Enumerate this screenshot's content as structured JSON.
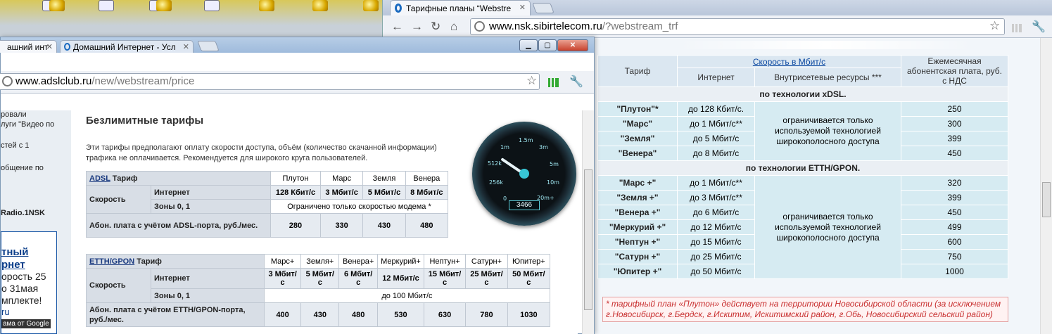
{
  "right_window": {
    "tab_title": "Тарифные планы “Webstre",
    "url_domain": "www.nsk.sibirtelecom.ru",
    "url_path": "/?webstream_trf",
    "table": {
      "head_tariff": "Тариф",
      "head_speed": "Скорость в Мбит/с",
      "head_internet": "Интернет",
      "head_intranet": "Внутрисетевые ресурсы ***",
      "head_fee": "Ежемесячная абонентская плата, руб. с НДС",
      "group_xdsl": "по технологии xDSL.",
      "group_etth": "по технологии ЕТТН/GPON.",
      "intranet_note": "ограничивается только используемой технологией широкополосного доступа",
      "xdsl_rows": [
        {
          "name": "\"Плутон\"*",
          "speed": "до 128 Кбит/с.",
          "fee": "250"
        },
        {
          "name": "\"Марс\"",
          "speed": "до 1 Мбит/с**",
          "fee": "300"
        },
        {
          "name": "\"Земля\"",
          "speed": "до 5 Мбит/с",
          "fee": "399"
        },
        {
          "name": "\"Венера\"",
          "speed": "до 8 Мбит/с",
          "fee": "450"
        }
      ],
      "etth_rows": [
        {
          "name": "\"Марс +\"",
          "speed": "до 1 Мбит/с**",
          "fee": "320"
        },
        {
          "name": "\"Земля +\"",
          "speed": "до 3 Мбит/с**",
          "fee": "399"
        },
        {
          "name": "\"Венера +\"",
          "speed": "до 6 Мбит/с",
          "fee": "450"
        },
        {
          "name": "\"Меркурий +\"",
          "speed": "до 12 Мбит/с",
          "fee": "499"
        },
        {
          "name": "\"Нептун +\"",
          "speed": "до 15 Мбит/с",
          "fee": "600"
        },
        {
          "name": "\"Сатурн +\"",
          "speed": "до 25 Мбит/с",
          "fee": "750"
        },
        {
          "name": "\"Юпитер +\"",
          "speed": "до 50 Мбит/с",
          "fee": "1000"
        }
      ]
    },
    "footnote": "* тарифный план «Плутон» действует на территории Новосибирской области (за исключением г.Новосибирск, г.Бердск, г.Искитим, Искитимский район, г.Обь, Новосибирский сельский район)"
  },
  "left_window": {
    "tab1_title": "ашний инт",
    "tab2_title": "Домашний Интернет - Усл",
    "url_domain": "www.adslclub.ru",
    "url_path": "/new/webstream/price",
    "sidebar": [
      "ровали",
      "луги \"Видео по",
      "стей с 1",
      "общение по",
      "Radio.1NSK"
    ],
    "promo": [
      "тный",
      "рнет",
      "орость 25",
      "о 31мая",
      "мплекте!",
      "ru",
      "ама от Google"
    ],
    "heading": "Безлимитные тарифы",
    "intro": "Эти тарифы предполагают оплату скорости доступа, объём (количество скачанной информации) трафика не оплачивается. Рекомендуется для широкого круга пользователей.",
    "adsl": {
      "label_link": "ADSL",
      "label_rest": " Тариф",
      "plans": [
        "Плутон",
        "Марс",
        "Земля",
        "Венера"
      ],
      "speed_label": "Скорость",
      "internet_label": "Интернет",
      "zones_label": "Зоны 0, 1",
      "internet": [
        "128 Кбит/с",
        "3 Мбит/с",
        "5 Мбит/с",
        "8 Мбит/с"
      ],
      "zones_value": "Ограничено только скоростью модема *",
      "fee_label": "Абон. плата с учётом ADSL-порта, руб./мес.",
      "fees": [
        "280",
        "330",
        "430",
        "480"
      ]
    },
    "etth": {
      "label_link": "ETTH/GPON",
      "label_rest": " Тариф",
      "plans": [
        "Марс+",
        "Земля+",
        "Венера+",
        "Меркурий+",
        "Нептун+",
        "Сатурн+",
        "Юпитер+"
      ],
      "speed_label": "Скорость",
      "internet_label": "Интернет",
      "zones_label": "Зоны 0, 1",
      "internet": [
        "3 Мбит/с",
        "5 Мбит/с",
        "6 Мбит/с",
        "12 Мбит/с",
        "15 Мбит/с",
        "25 Мбит/с",
        "50 Мбит/с"
      ],
      "zones_value": "до 100 Мбит/с",
      "fee_label": "Абон. плата с учётом ETTH/GPON-порта, руб./мес.",
      "fees": [
        "400",
        "430",
        "480",
        "530",
        "630",
        "780",
        "1030"
      ]
    },
    "gauge": {
      "labels": [
        "0",
        "256k",
        "512k",
        "1m",
        "1.5m",
        "3m",
        "5m",
        "10m",
        "20m+"
      ],
      "counter": "3466"
    }
  },
  "icons": [
    "desktop-icon",
    "chrome-tab-favicon",
    "back-arrow-icon",
    "forward-arrow-icon",
    "reload-icon",
    "home-icon",
    "globe-icon",
    "star-icon",
    "signal-icon",
    "wrench-icon",
    "minimize-icon",
    "maximize-icon",
    "close-icon"
  ]
}
